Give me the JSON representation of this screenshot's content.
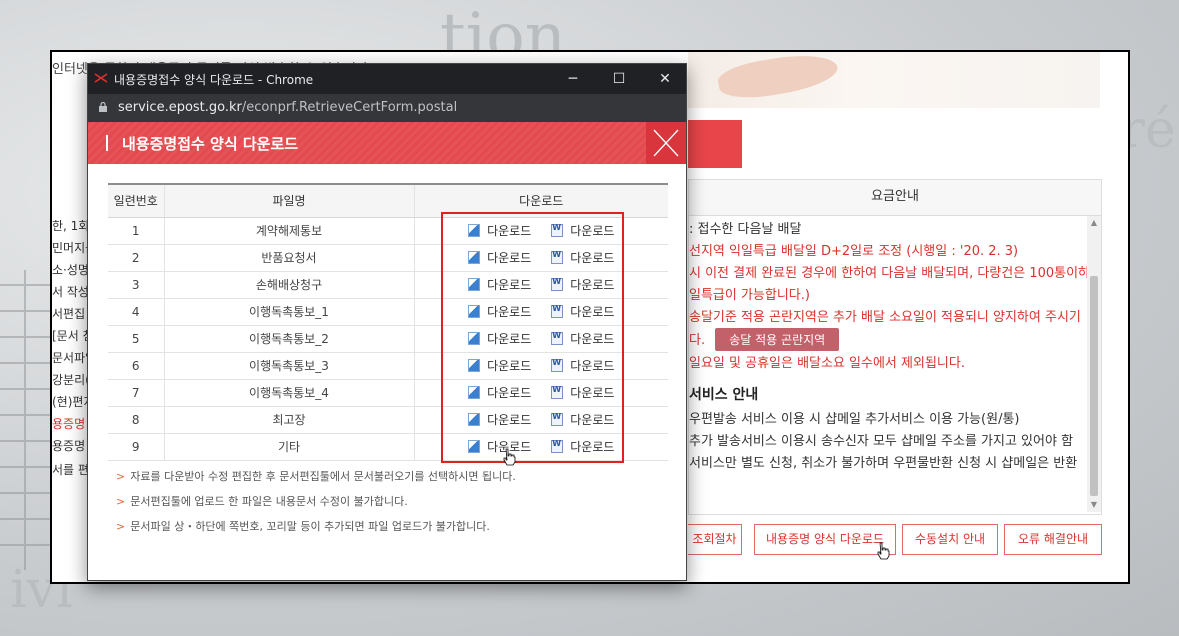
{
  "background": {
    "words": [
      "tion",
      "ré",
      "ivi"
    ]
  },
  "underlying_page": {
    "top_text": "인터넷을 통하여 내용증명 문서를 작성 발송할 수 있습니다",
    "left_column_lines": [
      "한, 1회",
      "민머지를",
      "소·성명,",
      "서 작성 ",
      "서편집 ",
      "[문서 첨",
      "문서파일",
      "강분리(",
      "(현)편지",
      "용증명 ",
      "용증명 ",
      "서를 편"
    ],
    "fee_panel": {
      "header": "요금안내",
      "lines": [
        {
          "text": ": 접수한 다음날 배달",
          "style": "dark"
        },
        {
          "text": "선지역 익일특급 배달일 D+2일로 조정 (시행일 : '20. 2. 3)",
          "style": "red"
        },
        {
          "text": "시 이전 결제 완료된 경우에 한하여 다음날 배달되며, 다량건은 100통이하",
          "style": "red"
        },
        {
          "text": "일특급이 가능합니다.)",
          "style": "red"
        },
        {
          "text": "송달기준 적용 곤란지역은 추가 배달 소요일이 적용되니 양지하여 주시기",
          "style": "red"
        },
        {
          "text": "다.",
          "style": "red"
        },
        {
          "text": "일요일 및 공휴일은 배달소요 일수에서 제외됩니다.",
          "style": "red"
        }
      ],
      "difficult_area_button": "송달 적용 곤란지역",
      "service_heading": "서비스 안내",
      "service_lines": [
        "우편발송 서비스 이용 시 샵메일 추가서비스 이용 가능(원/통)",
        "추가 발송서비스 이용시 송수신자 모두 샵메일 주소를 가지고 있어야 함",
        "서비스만 별도 신청, 취소가 불가하며 우편물반환 신청 시 샵메일은 반환"
      ]
    },
    "buttons": [
      "조회절차",
      "내용증명 양식 다운로드",
      "수동설치 안내",
      "오류 해결안내"
    ]
  },
  "popup": {
    "window_title": "내용증명접수 양식 다운로드 - Chrome",
    "window_buttons": {
      "minimize": "─",
      "maximize": "☐",
      "close": "✕"
    },
    "url_host": "service.epost.go.kr",
    "url_path": "/econprf.RetrieveCertForm.postal",
    "header_title": "내용증명접수 양식 다운로드",
    "table": {
      "columns": [
        "일련번호",
        "파일명",
        "다운로드"
      ],
      "rows": [
        {
          "no": "1",
          "name": "계약해제통보",
          "hwp": "다운로드",
          "doc": "다운로드"
        },
        {
          "no": "2",
          "name": "반품요청서",
          "hwp": "다운로드",
          "doc": "다운로드"
        },
        {
          "no": "3",
          "name": "손해배상청구",
          "hwp": "다운로드",
          "doc": "다운로드"
        },
        {
          "no": "4",
          "name": "이행독촉통보_1",
          "hwp": "다운로드",
          "doc": "다운로드"
        },
        {
          "no": "5",
          "name": "이행독촉통보_2",
          "hwp": "다운로드",
          "doc": "다운로드"
        },
        {
          "no": "6",
          "name": "이행독촉통보_3",
          "hwp": "다운로드",
          "doc": "다운로드"
        },
        {
          "no": "7",
          "name": "이행독촉통보_4",
          "hwp": "다운로드",
          "doc": "다운로드"
        },
        {
          "no": "8",
          "name": "최고장",
          "hwp": "다운로드",
          "doc": "다운로드"
        },
        {
          "no": "9",
          "name": "기타",
          "hwp": "다운로드",
          "doc": "다운로드"
        }
      ]
    },
    "notes": [
      "자료를 다운받아 수정 편집한 후 문서편집툴에서 문서불러오기를 선택하시면 됩니다.",
      "문서편집툴에 업로드 한 파일은 내용문서 수정이 불가합니다.",
      "문서파일 상・하단에 쪽번호, 꼬리말 등이 추가되면 파일 업로드가 불가합니다."
    ]
  },
  "colors": {
    "accent_red": "#e8454a",
    "highlight_box": "#e0221e",
    "title_bar": "#202124"
  },
  "icons": [
    "hwp-file-icon",
    "word-file-icon",
    "lock-icon",
    "epost-logo-icon",
    "hand-cursor-icon"
  ]
}
